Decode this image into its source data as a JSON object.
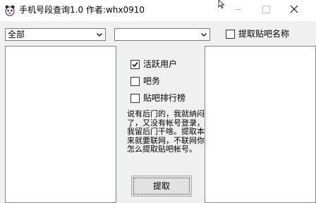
{
  "window": {
    "title": "手机号段查询1.0 作者:whx0910"
  },
  "filters": {
    "combo1_value": "全部",
    "combo2_value": "",
    "extract_post_name_label": "提取贴吧名称"
  },
  "options": [
    {
      "label": "活跃用户",
      "checked": true
    },
    {
      "label": "吧务",
      "checked": false
    },
    {
      "label": "贴吧排行榜",
      "checked": false
    }
  ],
  "notice": "说有后门的，我就纳闷了，又没有帐号登录，我留后门干啥。提取本来就要联网，不联网你怎么提取贴吧帐号。",
  "actions": {
    "extract_label": "提取"
  },
  "icons": {
    "app": "bear-face-icon",
    "minimize": "minimize-icon",
    "maximize": "maximize-icon",
    "close": "close-icon",
    "cursor": "mouse-cursor-icon",
    "dropdown": "chevron-down-icon",
    "check": "checkmark-icon"
  }
}
